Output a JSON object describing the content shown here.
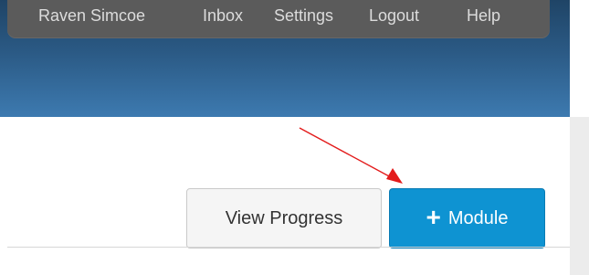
{
  "header": {
    "user_name": "Raven Simcoe",
    "links": [
      "Inbox",
      "Settings",
      "Logout",
      "Help"
    ]
  },
  "actions": {
    "view_progress_label": "View Progress",
    "add_module_label": "Module",
    "add_module_icon": "plus-icon"
  },
  "colors": {
    "primary": "#0e93d2",
    "nav_bar": "#5b5b5b",
    "header_blue": "#2b5a85",
    "annotation_arrow": "#e31b1b"
  },
  "annotation": {
    "icon": "red-arrow-icon"
  }
}
